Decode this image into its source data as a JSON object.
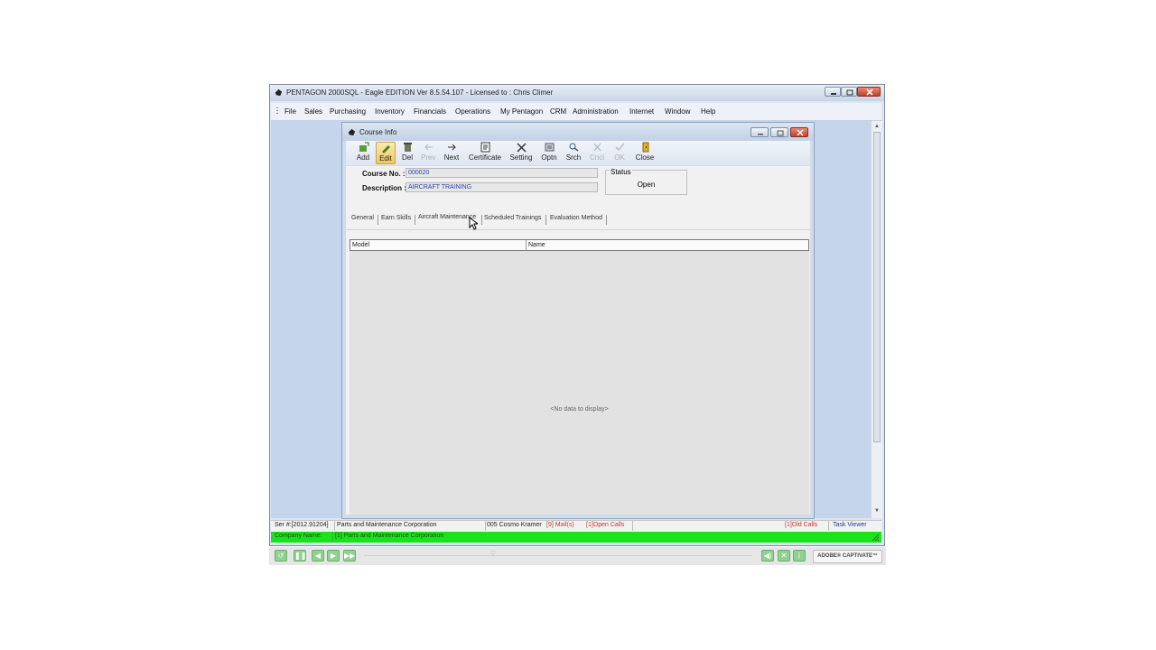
{
  "app": {
    "title": "PENTAGON 2000SQL - Eagle EDITION Ver 8.5.54.107 - Licensed to : Chris Climer",
    "menu": [
      "File",
      "Sales",
      "Purchasing",
      "Inventory",
      "Financials",
      "Operations",
      "My Pentagon",
      "CRM",
      "Administration",
      "Internet",
      "Window",
      "Help"
    ]
  },
  "child": {
    "title": "Course Info",
    "toolbar": [
      {
        "label": "Add",
        "icon": "add-icon",
        "enabled": true
      },
      {
        "label": "Edit",
        "icon": "edit-icon",
        "enabled": true,
        "pressed": true
      },
      {
        "label": "Del",
        "icon": "delete-icon",
        "enabled": true
      },
      {
        "label": "Prev",
        "icon": "prev-arrow-icon",
        "enabled": false
      },
      {
        "label": "Next",
        "icon": "next-arrow-icon",
        "enabled": true
      },
      {
        "label": "Certificate",
        "icon": "certificate-icon",
        "enabled": true
      },
      {
        "label": "Setting",
        "icon": "tools-icon",
        "enabled": true
      },
      {
        "label": "Optn",
        "icon": "options-icon",
        "enabled": true
      },
      {
        "label": "Srch",
        "icon": "search-icon",
        "enabled": true
      },
      {
        "label": "Cncl",
        "icon": "cancel-x-icon",
        "enabled": false
      },
      {
        "label": "OK",
        "icon": "check-icon",
        "enabled": false
      },
      {
        "label": "Close",
        "icon": "door-close-icon",
        "enabled": true
      }
    ],
    "form": {
      "course_no_label": "Course No. :",
      "course_no_value": "000020",
      "description_label": "Description :",
      "description_value": "AIRCRAFT TRAINING",
      "status_caption": "Status",
      "status_value": "Open"
    },
    "tabs": [
      "General",
      "Earn Skills",
      "Aircraft Maintenance",
      "Scheduled Trainings",
      "Evaluation Method"
    ],
    "active_tab": "Aircraft Maintenance",
    "grid": {
      "columns": [
        "Model",
        "Name"
      ],
      "empty_text": "<No data to display>"
    }
  },
  "statusbar": {
    "serial": "Ser #:[2012.91204]",
    "company": "Parts and Maintenance Corporation",
    "user": "005 Cosmo Kramer",
    "mails": "[9] Mail(s)",
    "open_calls": "[1]Open Calls",
    "old_calls": "[1]Old Calls",
    "task_viewer": "Task Viewer"
  },
  "companybar": {
    "label": "Company Name:",
    "value": "[1]   Parts and Maintenance Corporation"
  },
  "playbar": {
    "brand": "ADOBE® CAPTIVATE™"
  },
  "colors": {
    "mdi_background": "#c5d6ec",
    "company_bar": "#1be31b",
    "input_text": "#2c3da6",
    "alert_text": "#c0392b"
  }
}
